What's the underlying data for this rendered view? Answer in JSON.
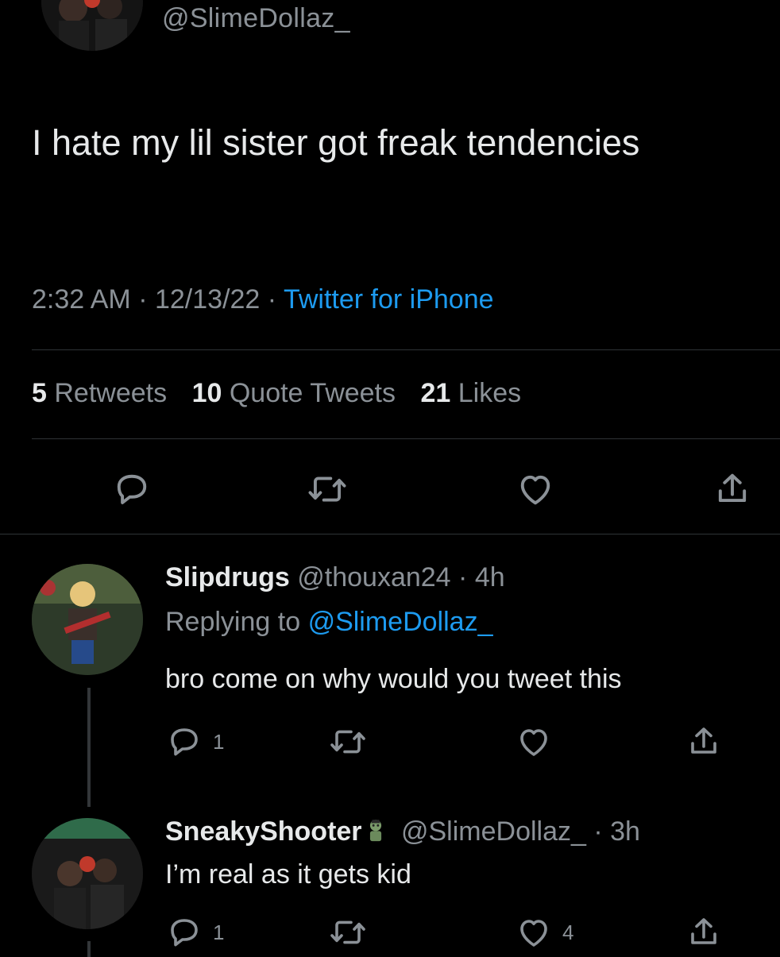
{
  "tweet": {
    "handle": "@SlimeDollaz_",
    "text": "I hate my lil sister got freak tendencies",
    "time": "2:32 AM",
    "date": "12/13/22",
    "source": "Twitter for iPhone",
    "retweets_count": "5",
    "retweets_label": "Retweets",
    "quotes_count": "10",
    "quotes_label": "Quote Tweets",
    "likes_count": "21",
    "likes_label": "Likes"
  },
  "replies": [
    {
      "name": "Slipdrugs",
      "handle": "@thouxan24",
      "age": "4h",
      "replying_prefix": "Replying to",
      "replying_to": "@SlimeDollaz_",
      "text": "bro come on why would you tweet this",
      "reply_count": "1",
      "retweet_count": "",
      "like_count": ""
    },
    {
      "name": "SneakyShooter",
      "handle": "@SlimeDollaz_",
      "age": "3h",
      "text": "I’m real as it gets kid",
      "reply_count": "1",
      "retweet_count": "",
      "like_count": "4"
    }
  ],
  "colors": {
    "background": "#000000",
    "text": "#e7e9ea",
    "muted": "#8b9197",
    "link": "#1d9bf0",
    "divider": "#2f3336"
  },
  "icons": [
    "reply-icon",
    "retweet-icon",
    "like-icon",
    "share-icon",
    "zombie-emoji-icon"
  ]
}
